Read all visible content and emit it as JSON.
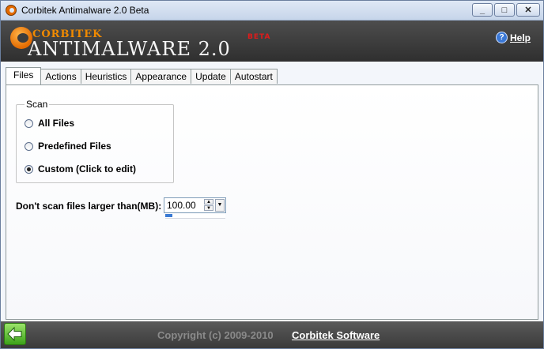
{
  "window": {
    "title": "Corbitek Antimalware 2.0 Beta",
    "controls": {
      "minimize": "_",
      "maximize": "□",
      "close": "✕"
    }
  },
  "banner": {
    "logo_small": "CORBITEK",
    "logo_big": "ANTIMALWARE 2.0",
    "logo_beta": "BETA",
    "help_label": "Help",
    "help_icon": "help-icon"
  },
  "tabs": [
    {
      "label": "Files",
      "active": true
    },
    {
      "label": "Actions"
    },
    {
      "label": "Heuristics"
    },
    {
      "label": "Appearance"
    },
    {
      "label": "Update"
    },
    {
      "label": "Autostart"
    }
  ],
  "scan": {
    "group_label": "Scan",
    "options": [
      {
        "label": "All Files",
        "checked": false
      },
      {
        "label": "Predefined Files",
        "checked": false
      },
      {
        "label": "Custom (Click to edit)",
        "checked": true
      }
    ]
  },
  "size_limit": {
    "label": "Don't scan files larger than(MB):",
    "value": "100.00",
    "bar_fraction": 0.12
  },
  "footer": {
    "copyright": "Copyright (c) 2009-2010",
    "company": "Corbitek Software"
  },
  "colors": {
    "accent": "#3b7bd4",
    "logo_orange": "#f08a00",
    "beta_red": "#e01b1b",
    "banner_bg": "#3a3a3a"
  }
}
